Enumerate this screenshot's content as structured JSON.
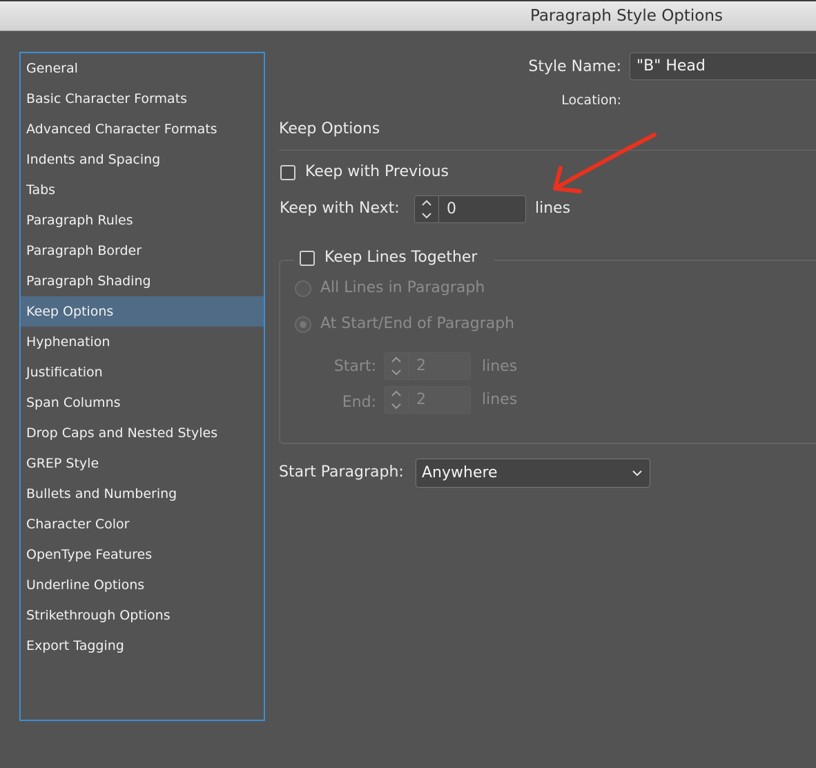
{
  "window": {
    "title": "Paragraph Style Options"
  },
  "sidebar": {
    "items": [
      {
        "label": "General"
      },
      {
        "label": "Basic Character Formats"
      },
      {
        "label": "Advanced Character Formats"
      },
      {
        "label": "Indents and Spacing"
      },
      {
        "label": "Tabs"
      },
      {
        "label": "Paragraph Rules"
      },
      {
        "label": "Paragraph Border"
      },
      {
        "label": "Paragraph Shading"
      },
      {
        "label": "Keep Options"
      },
      {
        "label": "Hyphenation"
      },
      {
        "label": "Justification"
      },
      {
        "label": "Span Columns"
      },
      {
        "label": "Drop Caps and Nested Styles"
      },
      {
        "label": "GREP Style"
      },
      {
        "label": "Bullets and Numbering"
      },
      {
        "label": "Character Color"
      },
      {
        "label": "OpenType Features"
      },
      {
        "label": "Underline Options"
      },
      {
        "label": "Strikethrough Options"
      },
      {
        "label": "Export Tagging"
      }
    ],
    "selected": "Keep Options"
  },
  "header": {
    "style_name_label": "Style Name:",
    "style_name_value": "\"B\" Head",
    "location_label": "Location:"
  },
  "section": {
    "title": "Keep Options"
  },
  "keep": {
    "with_previous_label": "Keep with Previous",
    "with_previous_checked": false,
    "with_next_label": "Keep with Next:",
    "with_next_value": "0",
    "with_next_unit": "lines"
  },
  "lines_together": {
    "label": "Keep Lines Together",
    "checked": false,
    "all_lines_label": "All Lines in Paragraph",
    "start_end_label": "At Start/End of Paragraph",
    "start_label": "Start:",
    "start_value": "2",
    "start_unit": "lines",
    "end_label": "End:",
    "end_value": "2",
    "end_unit": "lines"
  },
  "start_paragraph": {
    "label": "Start Paragraph:",
    "value": "Anywhere"
  },
  "colors": {
    "background": "#535353",
    "selection": "#4f6b85",
    "focus_ring": "#3b8fd6",
    "annotation_arrow": "#e8321e"
  }
}
